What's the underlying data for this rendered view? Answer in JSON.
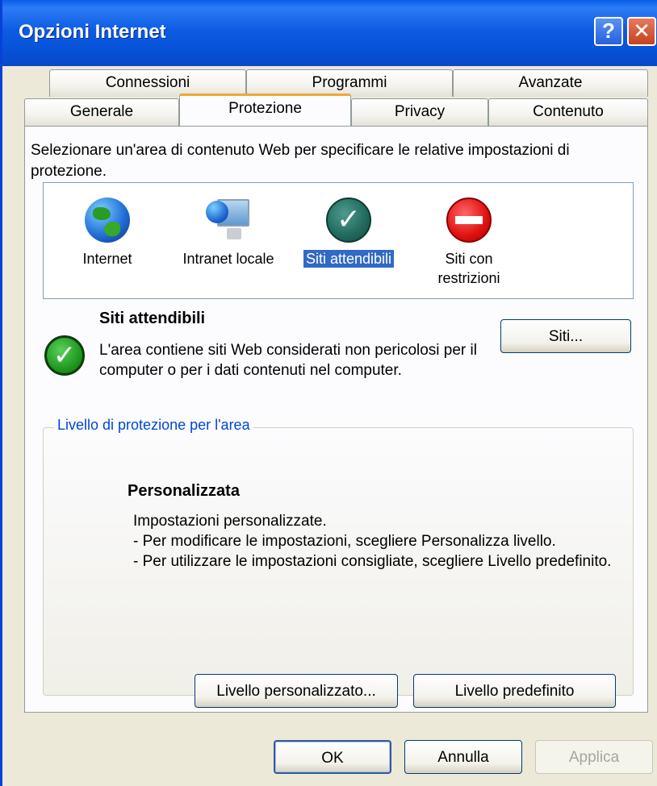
{
  "window": {
    "title": "Opzioni Internet",
    "help_label": "?",
    "close_label": "✕"
  },
  "tabs_row1": [
    "Connessioni",
    "Programmi",
    "Avanzate"
  ],
  "tabs_row2": [
    "Generale",
    "Protezione",
    "Privacy",
    "Contenuto"
  ],
  "active_tab": "Protezione",
  "instruction": "Selezionare un'area di contenuto Web per specificare le relative impostazioni di protezione.",
  "zones": [
    {
      "label": "Internet",
      "icon": "globe-icon"
    },
    {
      "label": "Intranet locale",
      "icon": "intranet-monitor-icon"
    },
    {
      "label": "Siti attendibili",
      "icon": "trusted-check-icon",
      "selected": true
    },
    {
      "label_line1": "Siti con",
      "label_line2": "restrizioni",
      "icon": "restricted-no-entry-icon"
    }
  ],
  "selected_zone": {
    "title": "Siti attendibili",
    "description": "L'area contiene siti Web considerati non pericolosi per il computer o per i dati contenuti nel computer.",
    "sites_button": "Siti..."
  },
  "security_level": {
    "legend": "Livello di protezione per l'area",
    "title": "Personalizzata",
    "line1": "Impostazioni personalizzate.",
    "line2": "- Per modificare le impostazioni, scegliere Personalizza livello.",
    "line3": "- Per utilizzare le impostazioni consigliate, scegliere Livello predefinito.",
    "custom_button": "Livello personalizzato...",
    "default_button": "Livello predefinito"
  },
  "footer": {
    "ok": "OK",
    "cancel": "Annulla",
    "apply": "Applica"
  },
  "colors": {
    "titlebar": "#0a5ee6",
    "selection": "#316ac5",
    "active_tab_accent": "#f0a830",
    "legend": "#0046d5"
  }
}
